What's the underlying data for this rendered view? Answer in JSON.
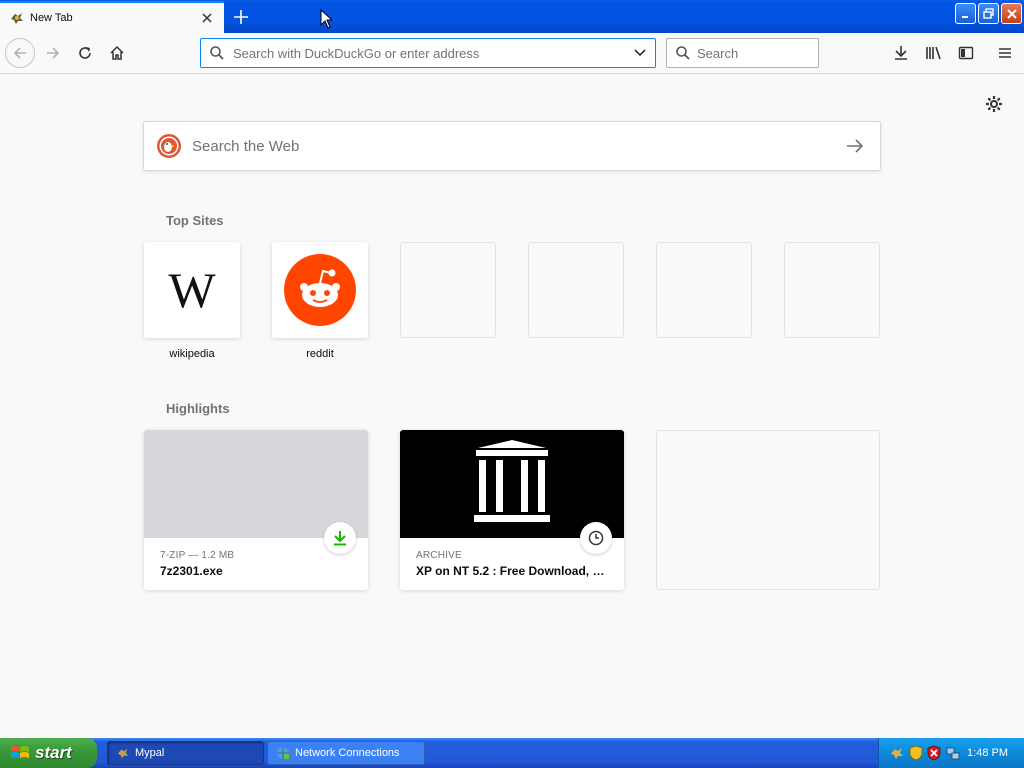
{
  "browser": {
    "tab": {
      "title": "New Tab"
    },
    "url_placeholder": "Search with DuckDuckGo or enter address",
    "search_placeholder": "Search"
  },
  "newtab": {
    "web_search_placeholder": "Search the Web",
    "top_sites_title": "Top Sites",
    "top_sites": [
      {
        "label": "wikipedia",
        "icon": "wikipedia-logo"
      },
      {
        "label": "reddit",
        "icon": "reddit-logo"
      },
      {
        "label": ""
      },
      {
        "label": ""
      },
      {
        "label": ""
      },
      {
        "label": ""
      }
    ],
    "highlights_title": "Highlights",
    "highlights": [
      {
        "meta": "7-ZIP — 1.2 MB",
        "title": "7z2301.exe",
        "badge": "download-icon"
      },
      {
        "meta": "ARCHIVE",
        "title": "XP on NT 5.2 : Free Download, B...",
        "badge": "clock-icon"
      }
    ]
  },
  "taskbar": {
    "start_label": "start",
    "items": [
      {
        "label": "Mypal"
      },
      {
        "label": "Network Connections"
      }
    ],
    "clock": "1:48 PM"
  },
  "colors": {
    "accent": "#0a84ff",
    "reddit": "#ff4500",
    "download_green": "#12bc00",
    "xp_blue": "#245edb",
    "xp_green": "#3a9a3a"
  }
}
